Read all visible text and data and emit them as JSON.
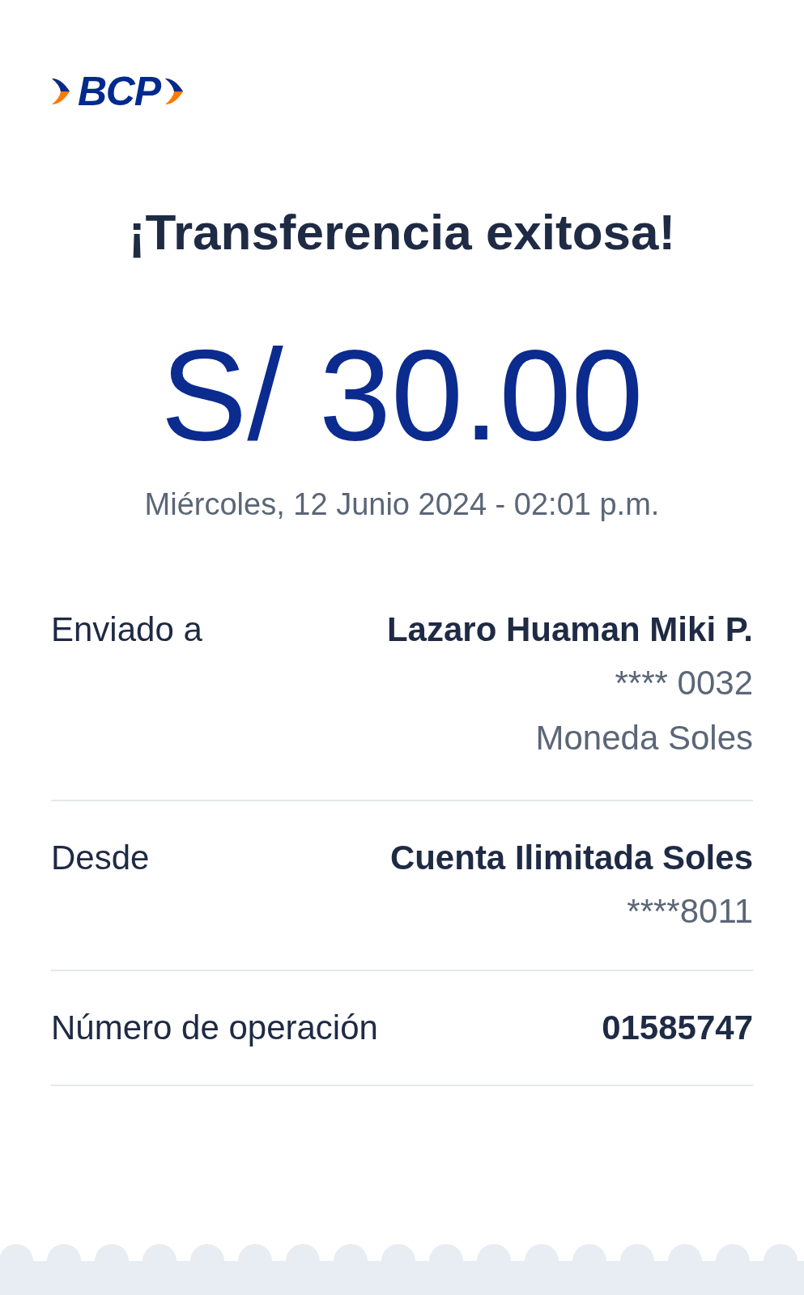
{
  "logo": {
    "text": "BCP"
  },
  "title": "¡Transferencia exitosa!",
  "amount": "S/ 30.00",
  "datetime": "Miércoles, 12 Junio 2024 - 02:01 p.m.",
  "details": [
    {
      "label": "Enviado a",
      "value": "Lazaro Huaman Miki P.",
      "lines": [
        "**** 0032",
        "Moneda Soles"
      ]
    },
    {
      "label": "Desde",
      "value": "Cuenta Ilimitada Soles",
      "lines": [
        "****8011"
      ]
    },
    {
      "label": "Número de operación",
      "value": "01585747"
    }
  ]
}
